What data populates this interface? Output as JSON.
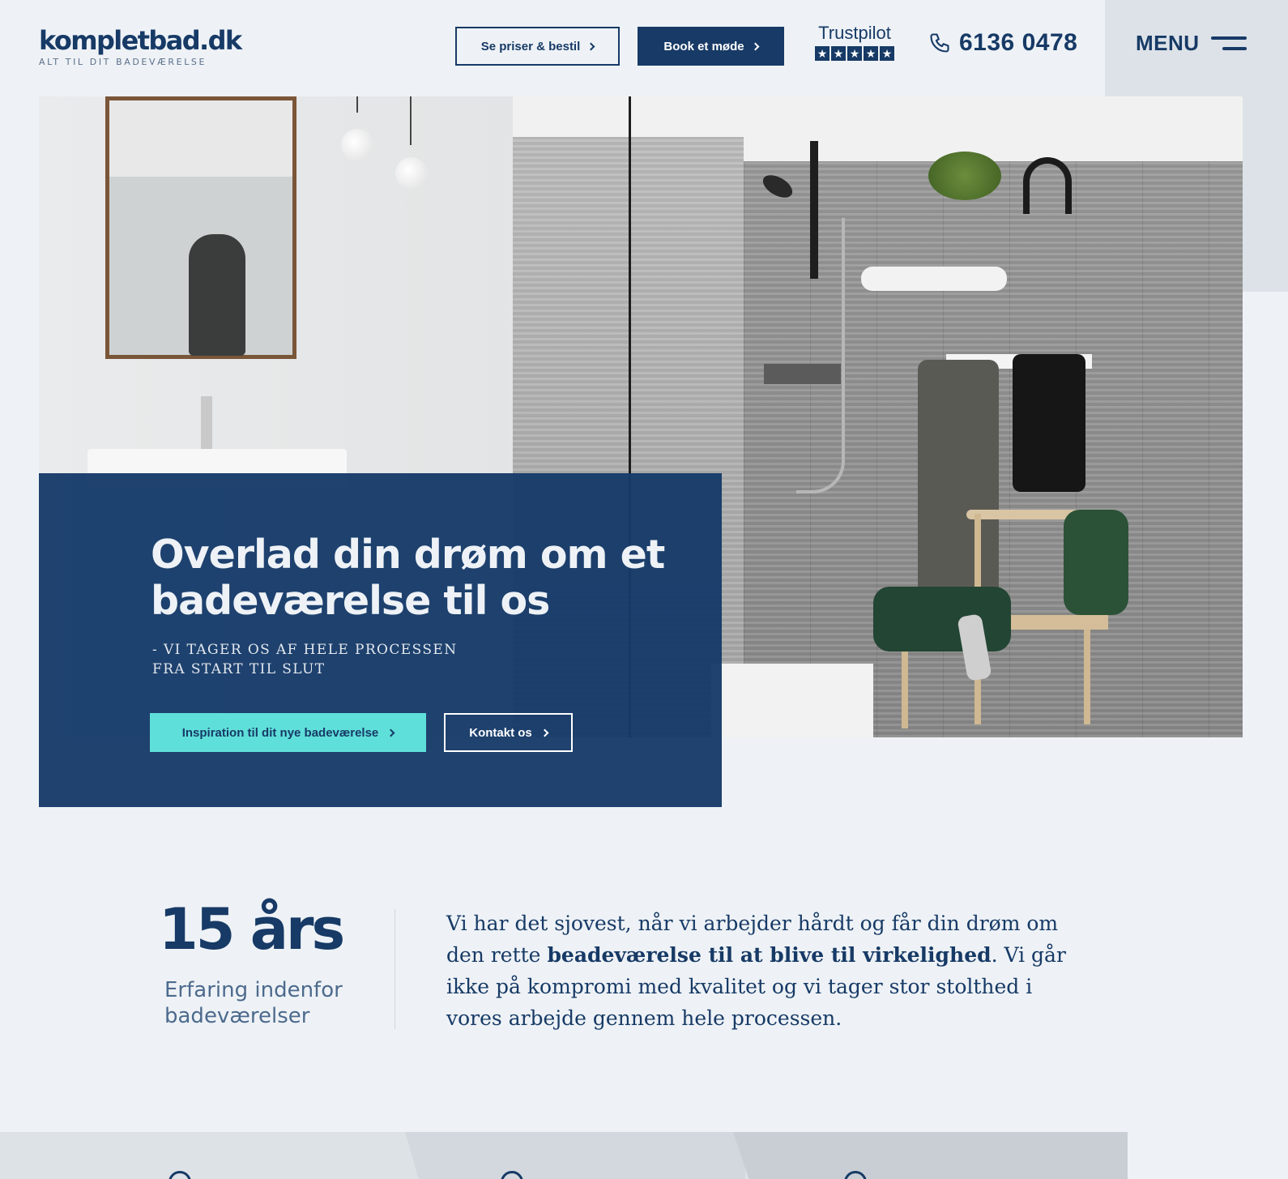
{
  "header": {
    "logo": {
      "name": "kompletbad.dk",
      "tagline": "ALT TIL DIT BADEVÆRELSE"
    },
    "buttons": {
      "prices": "Se priser & bestil",
      "book": "Book et møde"
    },
    "trustpilot": {
      "label": "Trustpilot",
      "stars": 5
    },
    "phone": "6136 0478",
    "menu_label": "MENU"
  },
  "hero": {
    "title": "Overlad din drøm om et badeværelse til os",
    "subtitle": "- VI TAGER OS AF HELE PROCESSEN FRA START TIL SLUT",
    "cta_primary": "Inspiration til dit nye badeværelse",
    "cta_secondary": "Kontakt os"
  },
  "stats": {
    "number": "15 års",
    "label": "Erfaring indenfor badeværelser"
  },
  "intro": {
    "before": "Vi har det sjovest, når vi arbejder hårdt og får din drøm om den rette ",
    "bold": "beadeværelse til at blive til virkelighed",
    "after": ". Vi går ikke på kompromi med kvalitet og vi tager stor stolthed i vores arbejde gennem hele processen."
  },
  "colors": {
    "navy": "#173a66",
    "cyan": "#5fdfd9",
    "background": "#eef2f6"
  },
  "icons": [
    "phone-icon",
    "chevron-right-icon",
    "hamburger-icon",
    "star-icon"
  ]
}
